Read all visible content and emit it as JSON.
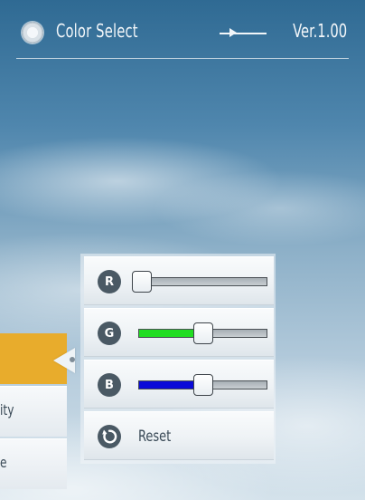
{
  "header": {
    "title": "Color Select",
    "version": "Ver.1.00"
  },
  "menu": {
    "items": [
      {
        "label": "",
        "active": true
      },
      {
        "label": "ity",
        "active": false
      },
      {
        "label": "e",
        "active": false
      }
    ]
  },
  "color_panel": {
    "sliders": [
      {
        "label": "R",
        "value_fraction": 0.03,
        "fill_color": "#ffffff"
      },
      {
        "label": "G",
        "value_fraction": 0.5,
        "fill_color": "#22dd22"
      },
      {
        "label": "B",
        "value_fraction": 0.5,
        "fill_color": "#0a0ad8"
      }
    ],
    "reset_label": "Reset"
  },
  "colors": {
    "accent": "#e8ac2c",
    "badge": "#4a5964"
  }
}
